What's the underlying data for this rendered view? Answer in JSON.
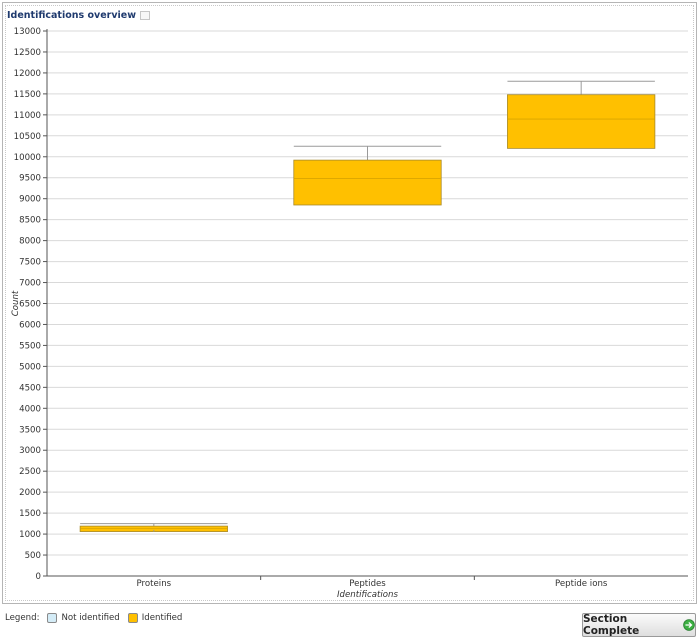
{
  "panel": {
    "title": "Identifications overview"
  },
  "legend": {
    "label": "Legend:",
    "items": [
      {
        "label": "Not identified",
        "color": "#d4ecf7"
      },
      {
        "label": "Identified",
        "color": "#ffc000"
      }
    ]
  },
  "actions": {
    "section_complete": "Section Complete",
    "next_icon": "arrow-right-circle-icon"
  },
  "chart_data": {
    "type": "boxplot",
    "title": "",
    "xlabel": "Identifications",
    "ylabel": "Count",
    "ylim": [
      0,
      13000
    ],
    "ytick_step": 500,
    "grid": true,
    "box_color": "#ffc000",
    "categories": [
      "Proteins",
      "Peptides",
      "Peptide ions"
    ],
    "boxes": [
      {
        "category": "Proteins",
        "min": 1100,
        "q1": 1060,
        "median": 1130,
        "q3": 1190,
        "max": 1250
      },
      {
        "category": "Peptides",
        "min": 8850,
        "q1": 8850,
        "median": 9480,
        "q3": 9920,
        "max": 10250
      },
      {
        "category": "Peptide ions",
        "min": 10200,
        "q1": 10200,
        "median": 10900,
        "q3": 11480,
        "max": 11800
      }
    ]
  }
}
